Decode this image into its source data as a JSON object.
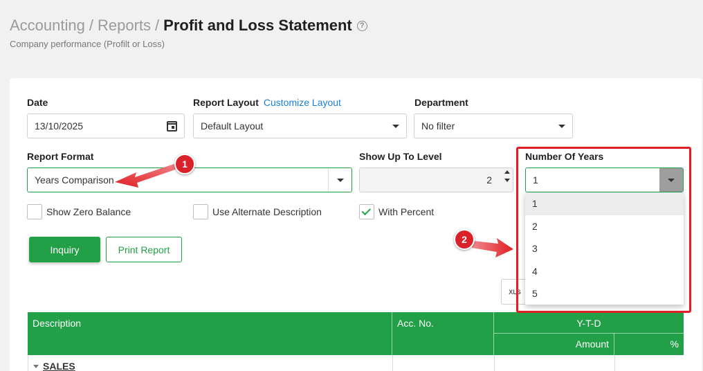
{
  "breadcrumb": {
    "accounting": "Accounting",
    "reports": "Reports",
    "separator": "/",
    "title": "Profit and Loss Statement",
    "help_icon": "?"
  },
  "subtitle": "Company performance (Profilt or Loss)",
  "form": {
    "date": {
      "label": "Date",
      "value": "13/10/2025",
      "icon": "calendar-icon"
    },
    "report_layout": {
      "label": "Report Layout",
      "link": "Customize Layout",
      "value": "Default Layout"
    },
    "department": {
      "label": "Department",
      "value": "No filter"
    },
    "report_format": {
      "label": "Report Format",
      "value": "Years Comparison"
    },
    "level": {
      "label": "Show Up To Level",
      "value": "2"
    },
    "years": {
      "label": "Number Of Years",
      "value": "1",
      "options": [
        "1",
        "2",
        "3",
        "4",
        "5"
      ]
    }
  },
  "checkboxes": {
    "zero_balance": {
      "label": "Show Zero Balance",
      "checked": false
    },
    "alt_desc": {
      "label": "Use Alternate Description",
      "checked": false
    },
    "with_percent": {
      "label": "With Percent",
      "checked": true
    }
  },
  "buttons": {
    "inquiry": "Inquiry",
    "print": "Print Report",
    "excel": "XLS"
  },
  "table": {
    "description": "Description",
    "acc_no": "Acc. No.",
    "ytd": "Y-T-D",
    "amount": "Amount",
    "percent": "%",
    "first_row": "SALES"
  },
  "annotations": {
    "badge_1": "1",
    "badge_2": "2"
  },
  "colors": {
    "primary": "#21a047",
    "annotation": "#e01e25",
    "link": "#1a7fd4"
  }
}
